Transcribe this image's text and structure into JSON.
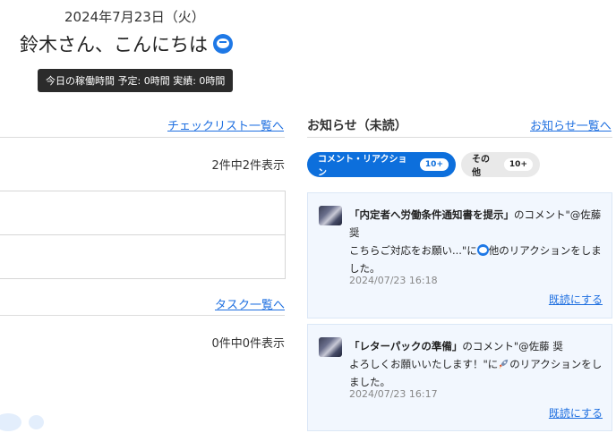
{
  "header": {
    "date": "2024年7月23日（火）",
    "greeting": "鈴木さん、こんにちは",
    "tooltip": "今日の稼働時間 予定: 0時間 実績: 0時間"
  },
  "left": {
    "checklist_link": "チェックリスト一覧へ",
    "checklist_count": "2件中2件表示",
    "task_link": "タスク一覧へ",
    "task_count": "0件中0件表示"
  },
  "notifications": {
    "title": "お知らせ（未読）",
    "link": "お知らせ一覧へ",
    "tabs": [
      {
        "label": "コメント・リアクション",
        "badge": "10+"
      },
      {
        "label": "その他",
        "badge": "10+"
      }
    ],
    "items": [
      {
        "title": "「内定者へ労働条件通知書を提示」",
        "text_after_title": "のコメント\"@佐藤 奨",
        "line2_before_icon": "こちらご対応をお願い...\"に",
        "line2_after_icon": "他のリアクションをしました。",
        "timestamp": "2024/07/23 16:18",
        "mark_read": "既読にする",
        "reaction_icon": "daruma-icon"
      },
      {
        "title": "「レターパックの準備」",
        "text_after_title": "のコメント\"@佐藤 奨",
        "line2_before_icon": "よろしくお願いいたします！\"に",
        "line2_after_icon": "のリアクションをしました。",
        "timestamp": "2024/07/23 16:17",
        "mark_read": "既読にする",
        "reaction_icon": "rocket-icon"
      }
    ]
  },
  "colors": {
    "accent": "#0d6fdc",
    "link": "#1e6fe0",
    "card_bg": "#f2f7fe"
  }
}
